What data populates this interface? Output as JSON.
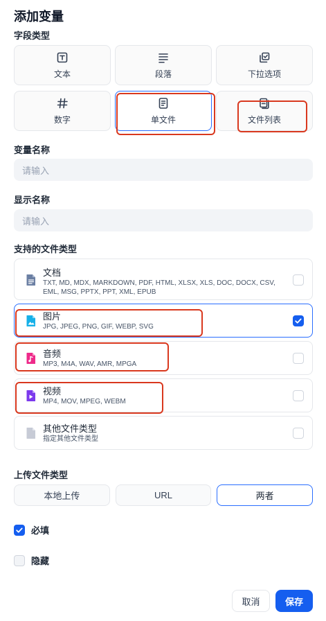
{
  "header": {
    "title": "添加变量"
  },
  "field_type": {
    "label": "字段类型",
    "options": [
      {
        "label": "文本",
        "icon": "text-icon"
      },
      {
        "label": "段落",
        "icon": "paragraph-icon"
      },
      {
        "label": "下拉选项",
        "icon": "select-icon"
      },
      {
        "label": "数字",
        "icon": "hash-icon"
      },
      {
        "label": "单文件",
        "icon": "file-icon"
      },
      {
        "label": "文件列表",
        "icon": "file-list-icon"
      }
    ],
    "selected": "单文件"
  },
  "variable_name": {
    "label": "变量名称",
    "placeholder": "请输入"
  },
  "display_name": {
    "label": "显示名称",
    "placeholder": "请输入"
  },
  "file_types": {
    "label": "支持的文件类型",
    "items": [
      {
        "name": "文档",
        "desc": "TXT, MD, MDX, MARKDOWN, PDF, HTML, XLSX, XLS, DOC, DOCX, CSV, EML, MSG, PPTX, PPT, XML, EPUB",
        "icon": "document-icon",
        "color": "#6b7fa3",
        "checked": false
      },
      {
        "name": "图片",
        "desc": "JPG, JPEG, PNG, GIF, WEBP, SVG",
        "icon": "image-icon",
        "color": "#16b0e8",
        "checked": true
      },
      {
        "name": "音频",
        "desc": "MP3, M4A, WAV, AMR, MPGA",
        "icon": "audio-icon",
        "color": "#ee2a8a",
        "checked": false
      },
      {
        "name": "视频",
        "desc": "MP4, MOV, MPEG, WEBM",
        "icon": "video-icon",
        "color": "#7c3aed",
        "checked": false
      },
      {
        "name": "其他文件类型",
        "desc": "指定其他文件类型",
        "icon": "other-file-icon",
        "color": "#c7cbd6",
        "checked": false
      }
    ]
  },
  "upload_type": {
    "label": "上传文件类型",
    "options": [
      "本地上传",
      "URL",
      "两者"
    ],
    "selected": "两者"
  },
  "required": {
    "label": "必填",
    "checked": true
  },
  "hidden": {
    "label": "隐藏",
    "checked": false
  },
  "actions": {
    "cancel": "取消",
    "save": "保存"
  },
  "colors": {
    "accent": "#155eef",
    "highlight": "#d9381e"
  }
}
